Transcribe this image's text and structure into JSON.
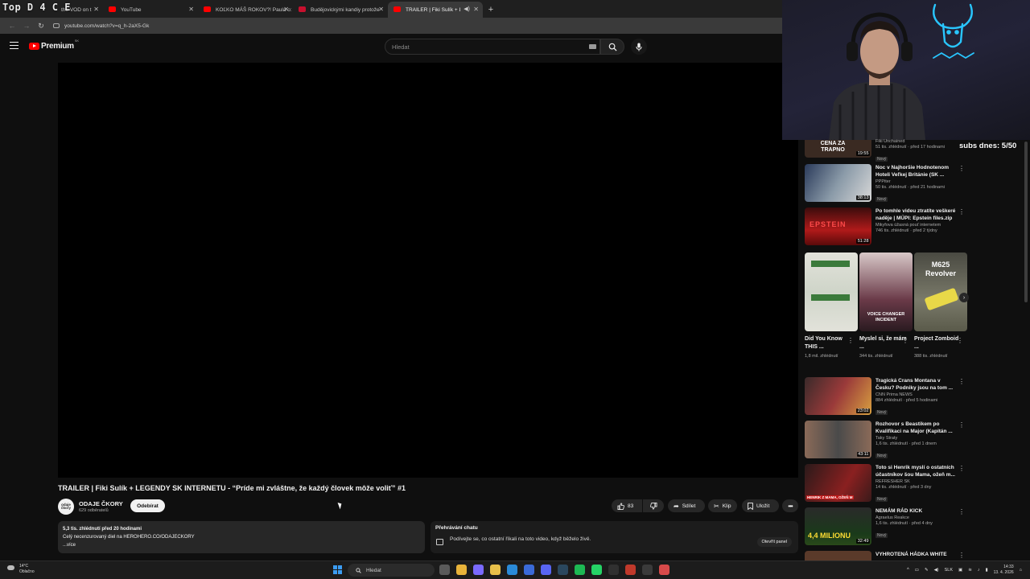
{
  "browser": {
    "vod_overlay": "Top D 4 C E",
    "tabs": [
      {
        "title": "the VOD on t",
        "icon": "vod"
      },
      {
        "title": "YouTube",
        "icon": "youtube"
      },
      {
        "title": "KOĽKO MÁŠ ROKOV?! Paula o:",
        "icon": "youtube"
      },
      {
        "title": "Budějovickými kandiy protože",
        "icon": "tn"
      },
      {
        "title": "TRAILER | Fiki Sulík + LEGE",
        "icon": "youtube",
        "active": true
      }
    ],
    "url": "youtube.com/watch?v=q_h-2aX5-Gk"
  },
  "youtube": {
    "logo_text": "Premium",
    "logo_region": "SK",
    "search_placeholder": "Hledat"
  },
  "video": {
    "title": "TRAILER | Fiki Sulík + LEGENDY SK INTERNETU - “Príde mi zvláštne, že každý človek môže voliť” #1",
    "channel_name": "ODAJE ČKORY",
    "channel_avatar_text": "odaje čkory",
    "subscribers": "629 odběratelů",
    "subscribe_label": "Odebírat",
    "like_count": "83",
    "share_label": "Sdílet",
    "clip_label": "Klip",
    "save_label": "Uložit",
    "description": {
      "views_line": "5,3 tis. zhlédnutí  před 20 hodinami",
      "text": "Celý necenzurovaný diel na HEROHERO.CO/ODAJECKORY",
      "more": "...více"
    },
    "chat": {
      "title": "Přehrávání chatu",
      "subtitle": "Podívejte se, co ostatní říkali na toto video, když běželo živě.",
      "open_label": "Otevřít panel"
    }
  },
  "overlay": {
    "subs_counter": "subs dnes: 5/50"
  },
  "sidebar": {
    "videos_top": [
      {
        "title": "",
        "channel": "Fiki Unchained",
        "meta": "51 tis. zhlédnutí · před 17 hodinami",
        "badge": "Nový",
        "duration": "19:55",
        "thumb_text": "CENA ZA TRAPNO",
        "thumb_color": "#3a2a22"
      },
      {
        "title": "Noc v Najhoršie Hodnotenom Hoteli Veľkej Británie (SK ...",
        "channel": "PPPiter",
        "meta": "50 tis. zhlédnutí · před 21 hodinami",
        "badge": "Nový",
        "duration": "38:13",
        "thumb_text": "",
        "thumb_color": "#5a6a7a"
      },
      {
        "title": "Po tomhle videu ztratíte veškeré naděje | MÚPI: Epstein files.zip",
        "channel": "Mikyfova úžasná pouť internetem",
        "meta": "746 tis. zhlédnutí · před 2 týdny",
        "badge": "",
        "duration": "51:28",
        "thumb_text": "EPSTEIN",
        "thumb_color": "#8a1a1a"
      }
    ],
    "shorts": [
      {
        "title": "Did You Know THIS ...",
        "meta": "1,8 mil. zhlédnutí",
        "thumb_text": "",
        "thumb_color": "#d8d8d0"
      },
      {
        "title": "Myslel si, že mám ...",
        "meta": "344 tis. zhlédnutí",
        "thumb_text": "VOICE CHANGER INCIDENT",
        "thumb_color": "#3a2530"
      },
      {
        "title": "Project Zomboid ...",
        "meta": "388 tis. zhlédnutí",
        "thumb_text": "M625 Revolver",
        "thumb_color": "#6a6a5a"
      }
    ],
    "videos_bottom": [
      {
        "title": "Tragická Crans Montana v Česku? Podniky jsou na tom ...",
        "channel": "CNN Prima NEWS",
        "meta": "884 zhlédnutí · před 5 hodinami",
        "badge": "Nový",
        "duration": "23:02",
        "thumb_text": "",
        "thumb_color": "#7a2020"
      },
      {
        "title": "Rozhovor s Beastikem po Kvalifikaci na Major (Kapitán ...",
        "channel": "Taky Straty",
        "meta": "1,6 tis. zhlédnutí · před 1 dnem",
        "badge": "Nový",
        "duration": "43:11",
        "thumb_text": "",
        "thumb_color": "#4a4a4a"
      },
      {
        "title": "Toto si Henrik myslí o ostatních účastníkov šou Mama, ožeň m...",
        "channel": "REFRESHER SK",
        "meta": "14 tis. zhlédnutí · před 3 dny",
        "badge": "Nový",
        "duration": "",
        "thumb_text": "HENRIK Z MAMA, OŽEŇ M",
        "thumb_color": "#6a1a1a"
      },
      {
        "title": "NEMÁM RÁD KICK",
        "channel": "Agraelus Reakce",
        "meta": "1,6 tis. zhlédnutí · před 4 dny",
        "badge": "Nový",
        "duration": "32:49",
        "thumb_text": "4,4 MILIONU",
        "thumb_color": "#2a3a2a"
      },
      {
        "title": "VYHROTENÁ HÁDKA WHITE",
        "channel": "",
        "meta": "",
        "badge": "",
        "duration": "",
        "thumb_text": "",
        "thumb_color": "#5a3a2a"
      }
    ]
  },
  "taskbar": {
    "weather_temp": "14°C",
    "weather_desc": "Oblačno",
    "search_placeholder": "Hledat",
    "lang": "SLK",
    "time": "14:33",
    "date": "13. 4. 2026",
    "apps": [
      {
        "name": "task-view",
        "color": "#5a5a5a"
      },
      {
        "name": "chrome",
        "color": "#e8b33a"
      },
      {
        "name": "copilot",
        "color": "#7a6aff"
      },
      {
        "name": "explorer",
        "color": "#e8c04a"
      },
      {
        "name": "edge",
        "color": "#2a8ad8"
      },
      {
        "name": "mail",
        "color": "#3a6ad8"
      },
      {
        "name": "discord",
        "color": "#5865f2"
      },
      {
        "name": "steam",
        "color": "#2a475e"
      },
      {
        "name": "spotify",
        "color": "#1db954"
      },
      {
        "name": "whatsapp",
        "color": "#25d366"
      },
      {
        "name": "obs",
        "color": "#303030"
      },
      {
        "name": "app-red",
        "color": "#c0392b"
      },
      {
        "name": "app-dark",
        "color": "#3a3a3a"
      },
      {
        "name": "app-multi",
        "color": "#d84a4a"
      }
    ]
  }
}
